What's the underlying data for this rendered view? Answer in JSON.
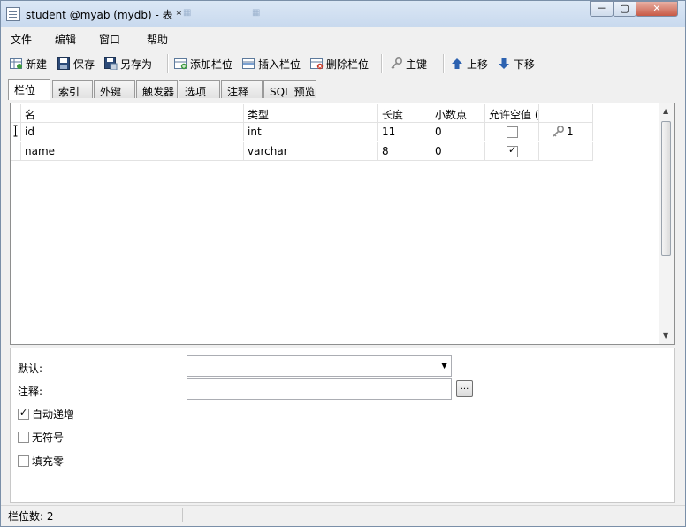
{
  "window": {
    "title": "student @myab (mydb) - 表 *",
    "controls": {
      "minimize": "－",
      "maximize": "▢",
      "close": "✕"
    }
  },
  "menu": [
    "文件",
    "编辑",
    "窗口",
    "帮助"
  ],
  "toolbar": {
    "new": "新建",
    "save": "保存",
    "save_as": "另存为",
    "add_field": "添加栏位",
    "insert_field": "插入栏位",
    "delete_field": "删除栏位",
    "primary_key": "主键",
    "move_up": "上移",
    "move_down": "下移"
  },
  "tabs": [
    "栏位",
    "索引",
    "外键",
    "触发器",
    "选项",
    "注释",
    "SQL 预览"
  ],
  "active_tab": "栏位",
  "grid": {
    "columns": [
      "名",
      "类型",
      "长度",
      "小数点",
      "允许空值 ("
    ],
    "rows": [
      {
        "name": "id",
        "type": "int",
        "length": "11",
        "decimals": "0",
        "allow_null": false,
        "key": "1"
      },
      {
        "name": "name",
        "type": "varchar",
        "length": "8",
        "decimals": "0",
        "allow_null": true,
        "key": ""
      }
    ]
  },
  "props": {
    "default_label": "默认:",
    "default_value": "",
    "comment_label": "注释:",
    "comment_value": "",
    "ellipsis": "...",
    "auto_increment": {
      "label": "自动递增",
      "checked": true
    },
    "unsigned": {
      "label": "无符号",
      "checked": false
    },
    "zerofill": {
      "label": "填充零",
      "checked": false
    }
  },
  "status": {
    "field_count": "栏位数: 2"
  },
  "colors": {
    "accent_blue": "#1d5fa8",
    "key_gold": "#b08a30"
  }
}
